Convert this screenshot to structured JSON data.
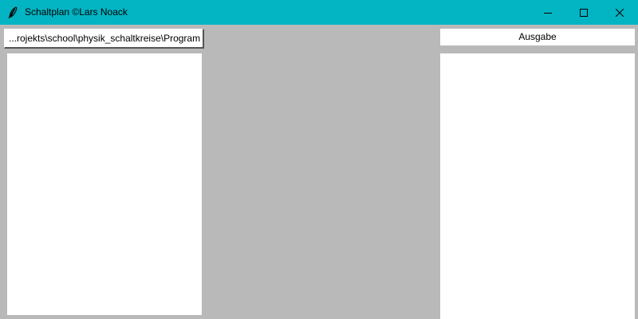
{
  "window": {
    "title": "Schaltplan ©Lars Noack",
    "icon": "feather-icon",
    "title_bar_color": "#03b4c3",
    "background_color": "#b9b9b9",
    "controls": {
      "minimize_icon": "minimize-icon",
      "maximize_icon": "maximize-icon",
      "close_icon": "close-icon"
    }
  },
  "toolbar": {
    "path_label": "...rojekts\\school\\physik_schaltkreise\\Program"
  },
  "output": {
    "label": "Ausgabe"
  }
}
